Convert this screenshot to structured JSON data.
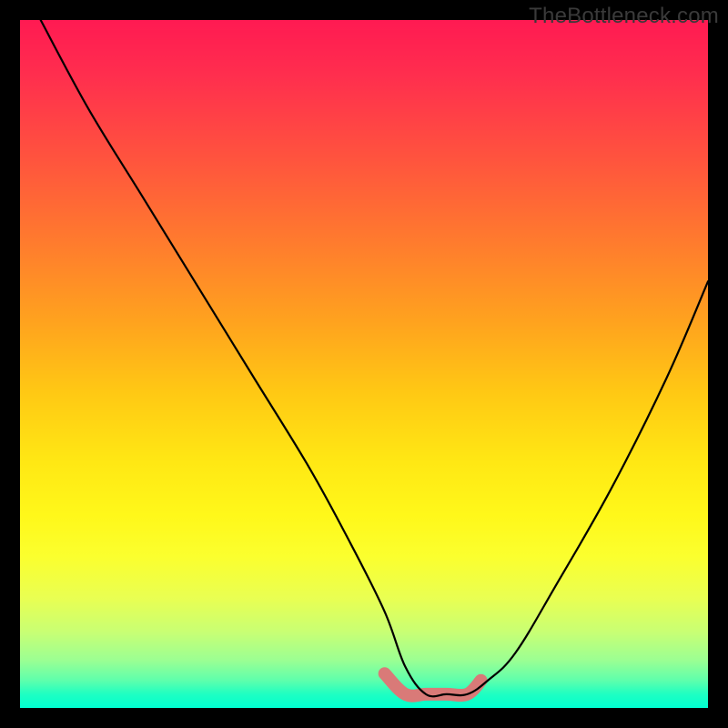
{
  "watermark": "TheBottleneck.com",
  "chart_data": {
    "type": "line",
    "title": "",
    "xlabel": "",
    "ylabel": "",
    "xlim": [
      0,
      100
    ],
    "ylim": [
      0,
      100
    ],
    "notes": "Bottleneck curve over a red-to-green vertical gradient. The curve shows high bottleneck (near 100) at x≈3, falling to a flat minimum (≈2) around x≈55–65, then rising toward ≈62 at x≈100. A short salmon-colored highlighted segment marks the flat minimum region.",
    "series": [
      {
        "name": "bottleneck-curve",
        "color": "#000000",
        "x": [
          3,
          10,
          18,
          26,
          34,
          42,
          48,
          53,
          56,
          59,
          62,
          65,
          68,
          72,
          78,
          86,
          94,
          100
        ],
        "values": [
          100,
          87,
          74,
          61,
          48,
          35,
          24,
          14,
          6,
          2,
          2,
          2,
          4,
          8,
          18,
          32,
          48,
          62
        ]
      }
    ],
    "highlight": {
      "color": "#d97a78",
      "x": [
        53,
        56,
        59,
        62,
        65,
        67
      ],
      "values": [
        5,
        2,
        2,
        2,
        2,
        4
      ]
    }
  }
}
